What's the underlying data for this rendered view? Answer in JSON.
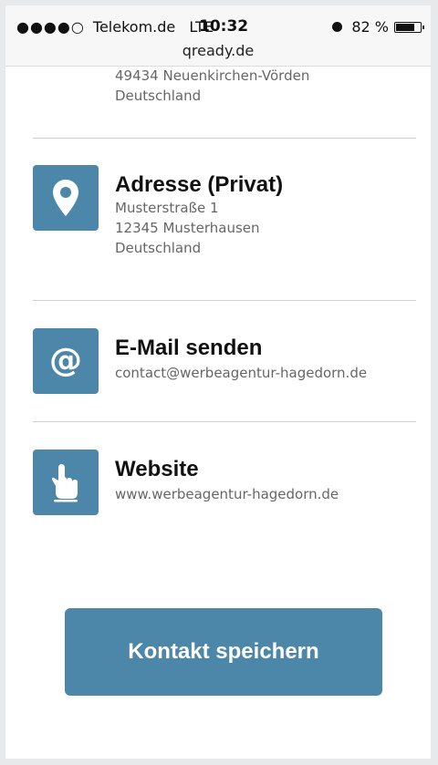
{
  "status_bar": {
    "signal": "●●●●○",
    "carrier": "Telekom.de",
    "network": "LTE",
    "time": "10:32",
    "battery": "82 %",
    "battery_level": 0.82,
    "url": "qready.de"
  },
  "previous_address": {
    "lines": [
      "49434 Neuenkirchen-Vörden",
      "Deutschland"
    ]
  },
  "address_private": {
    "icon": "map-pin-icon",
    "title": "Adresse (Privat)",
    "lines": [
      "Musterstraße 1",
      "12345 Musterhausen",
      "Deutschland"
    ]
  },
  "email": {
    "icon": "at-sign-icon",
    "title": "E-Mail senden",
    "value": "contact@werbeagentur-hagedorn.de"
  },
  "website": {
    "icon": "pointing-hand-icon",
    "title": "Website",
    "value": "www.werbeagentur-hagedorn.de"
  },
  "save_button": {
    "label": "Kontakt speichern"
  },
  "colors": {
    "accent": "#4c86a8"
  }
}
